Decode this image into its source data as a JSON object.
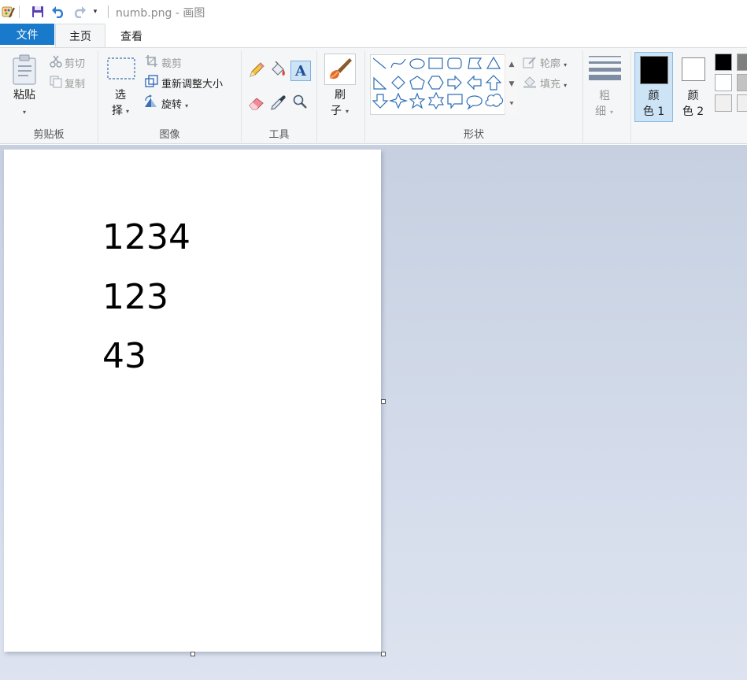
{
  "window": {
    "title": "numb.png - 画图"
  },
  "tabs": {
    "file": "文件",
    "home": "主页",
    "view": "查看"
  },
  "ribbon": {
    "clipboard": {
      "label": "剪贴板",
      "paste": "粘贴",
      "cut": "剪切",
      "copy": "复制"
    },
    "image": {
      "label": "图像",
      "select_1": "选",
      "select_2": "择",
      "crop": "裁剪",
      "resize": "重新调整大小",
      "rotate": "旋转"
    },
    "tools": {
      "label": "工具"
    },
    "brushes": {
      "label_1": "刷",
      "label_2": "子"
    },
    "shapes": {
      "label": "形状",
      "outline": "轮廓",
      "fill": "填充"
    },
    "size": {
      "label_1": "粗",
      "label_2": "细"
    },
    "colors": {
      "color1_1": "颜",
      "color1_2": "色 1",
      "color2_1": "颜",
      "color2_2": "色 2",
      "color1": "#000000",
      "color2": "#ffffff"
    }
  },
  "palette": [
    "#000000",
    "#7f7f7f",
    "#ffffff",
    "#c3c3c3",
    "#f0f0f0",
    "#f0f0f0"
  ],
  "canvas": {
    "lines": [
      "1234",
      "123",
      "43"
    ]
  },
  "accent": "#1979ca"
}
